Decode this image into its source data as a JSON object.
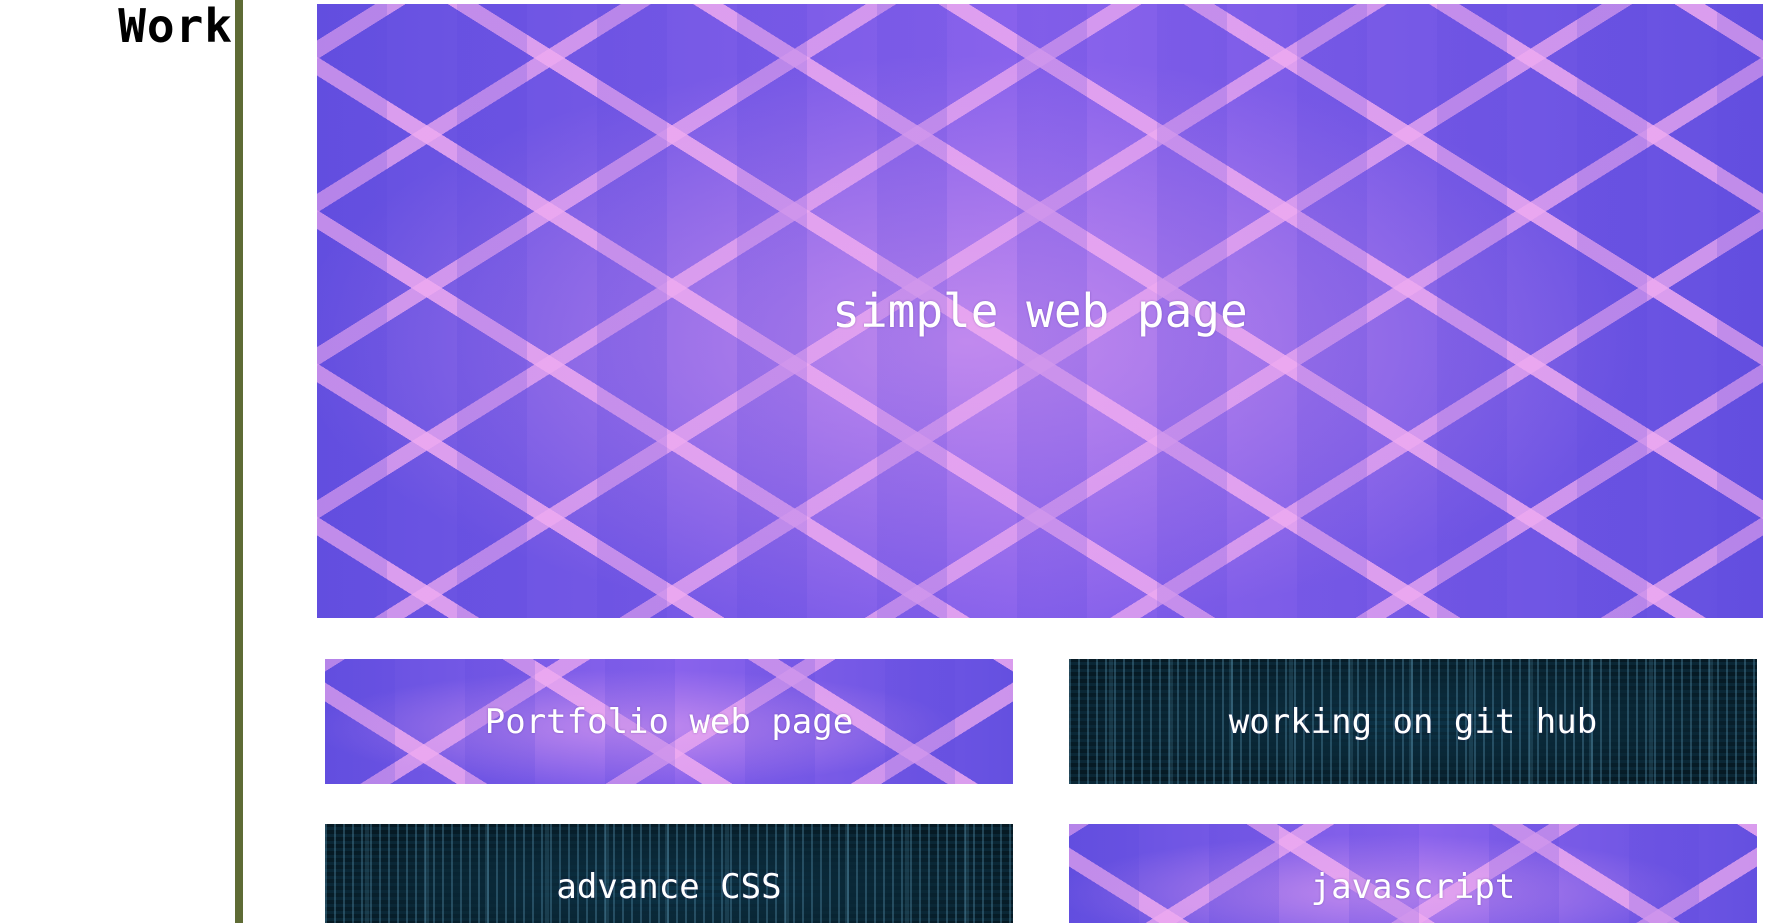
{
  "section": {
    "title": "Work"
  },
  "projects": [
    {
      "label": "simple web page",
      "style": "purple"
    },
    {
      "label": "Portfolio web page",
      "style": "purple"
    },
    {
      "label": "working on git hub",
      "style": "matrix"
    },
    {
      "label": "advance CSS",
      "style": "matrix"
    },
    {
      "label": "javascript",
      "style": "purple"
    }
  ],
  "colors": {
    "divider": "#5e6b35",
    "purple_bg": "#6c55e6",
    "matrix_bg": "#07222e",
    "tile_text": "#ffffff"
  }
}
